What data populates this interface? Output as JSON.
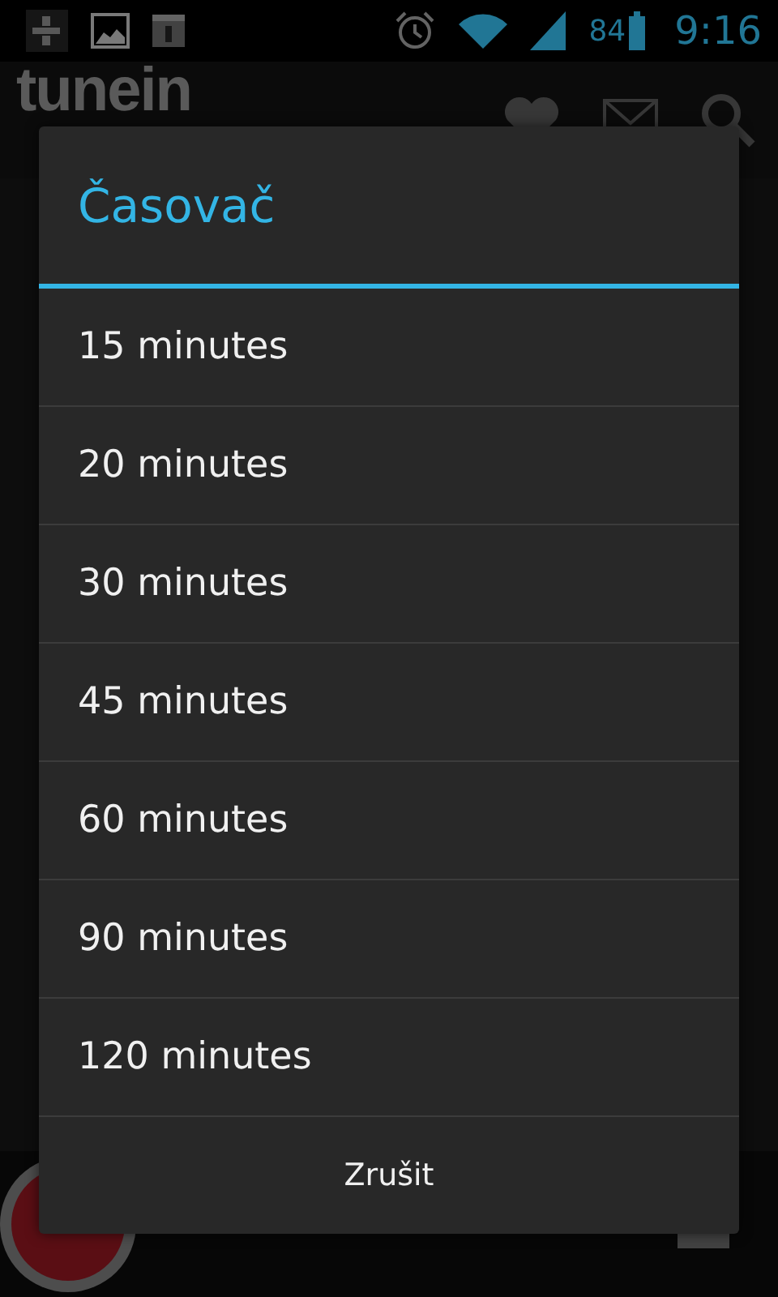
{
  "status_bar": {
    "battery": "84",
    "time": "9:16"
  },
  "app_bar": {
    "logo": "tunein"
  },
  "dialog": {
    "title": "Časovač",
    "options": [
      {
        "label": "15 minutes"
      },
      {
        "label": "20 minutes"
      },
      {
        "label": "30 minutes"
      },
      {
        "label": "45 minutes"
      },
      {
        "label": "60 minutes"
      },
      {
        "label": "90 minutes"
      },
      {
        "label": "120 minutes"
      }
    ],
    "cancel": "Zrušit"
  }
}
